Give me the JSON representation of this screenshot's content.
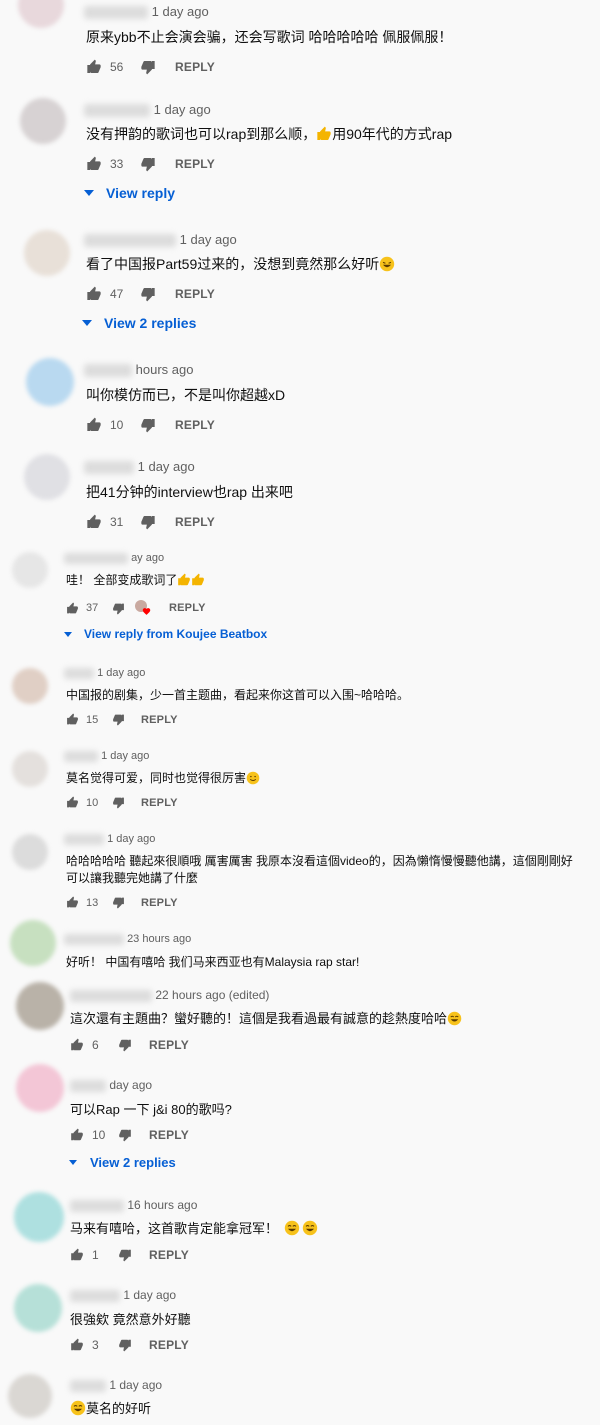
{
  "labels": {
    "reply": "REPLY"
  },
  "comments": [
    {
      "time": "1 day ago",
      "text": "原来ybb不止会演会骗，还会写歌词 哈哈哈哈哈 佩服佩服！",
      "likes": "56",
      "avatar_color": "#e8d8dc"
    },
    {
      "time": "1 day ago",
      "text_before": "没有押韵的歌词也可以rap到那么顺，",
      "text_after": "用90年代的方式rap",
      "likes": "33",
      "view_replies": "View reply",
      "avatar_color": "#d7d2d3"
    },
    {
      "time": "1 day ago",
      "text_before": "看了中国报Part59过来的，没想到竟然那么好听",
      "likes": "47",
      "view_replies": "View 2 replies",
      "avatar_color": "#e8e0d8"
    },
    {
      "time": "hours ago",
      "text": "叫你模仿而已，不是叫你超越xD",
      "likes": "10",
      "avatar_color": "#b9d9f0"
    },
    {
      "time": "1 day ago",
      "text": "把41分钟的interview也rap 出来吧",
      "likes": "31",
      "avatar_color": "#e0e0e4"
    },
    {
      "time": "ay ago",
      "text_before": "哇！ 全部变成歌词了",
      "likes": "37",
      "view_replies": "View reply from Koujee Beatbox",
      "avatar_color": "#e6e6e6"
    },
    {
      "time": "1 day ago",
      "text": "中国报的剧集，少一首主题曲，看起来你这首可以入围~哈哈哈。",
      "likes": "15",
      "avatar_color": "#e0cfc5"
    },
    {
      "time": "1 day ago",
      "text_before": "莫名觉得可爱，同时也觉得很厉害",
      "likes": "10",
      "avatar_color": "#e4e0dd"
    },
    {
      "time": "1 day ago",
      "text_line1": "哈哈哈哈哈 聽起來很順哦 厲害厲害 我原本沒看這個video的，因為懶惰慢慢聽他講，這個剛剛好",
      "text_line2": "可以讓我聽完她講了什麼",
      "likes": "13",
      "avatar_color": "#dcdcdc"
    },
    {
      "time": "23 hours ago",
      "text": "好听！ 中国有嘻哈 我们马来西亚也有Malaysia rap star!",
      "likes": "",
      "avatar_color": "#c7e0c0"
    },
    {
      "time": "22 hours ago (edited)",
      "text_before": "這次還有主題曲？蠻好聽的！這個是我看過最有誠意的趁熱度哈哈",
      "likes": "6",
      "avatar_color": "#b9b2a8"
    },
    {
      "time": "day ago",
      "text": "可以Rap 一下 j&i 80的歌吗?",
      "likes": "10",
      "view_replies": "View 2 replies",
      "avatar_color": "#f3c6d6"
    },
    {
      "time": "16 hours ago",
      "text_before": "马来有嘻哈，这首歌肯定能拿冠军！",
      "likes": "1",
      "avatar_color": "#aee0e0"
    },
    {
      "time": "1 day ago",
      "text": "很強欸 竟然意外好聽",
      "likes": "3",
      "avatar_color": "#b6e0d8"
    },
    {
      "time": "1 day ago",
      "text_after": "莫名的好听",
      "avatar_color": "#dad7d3"
    }
  ]
}
